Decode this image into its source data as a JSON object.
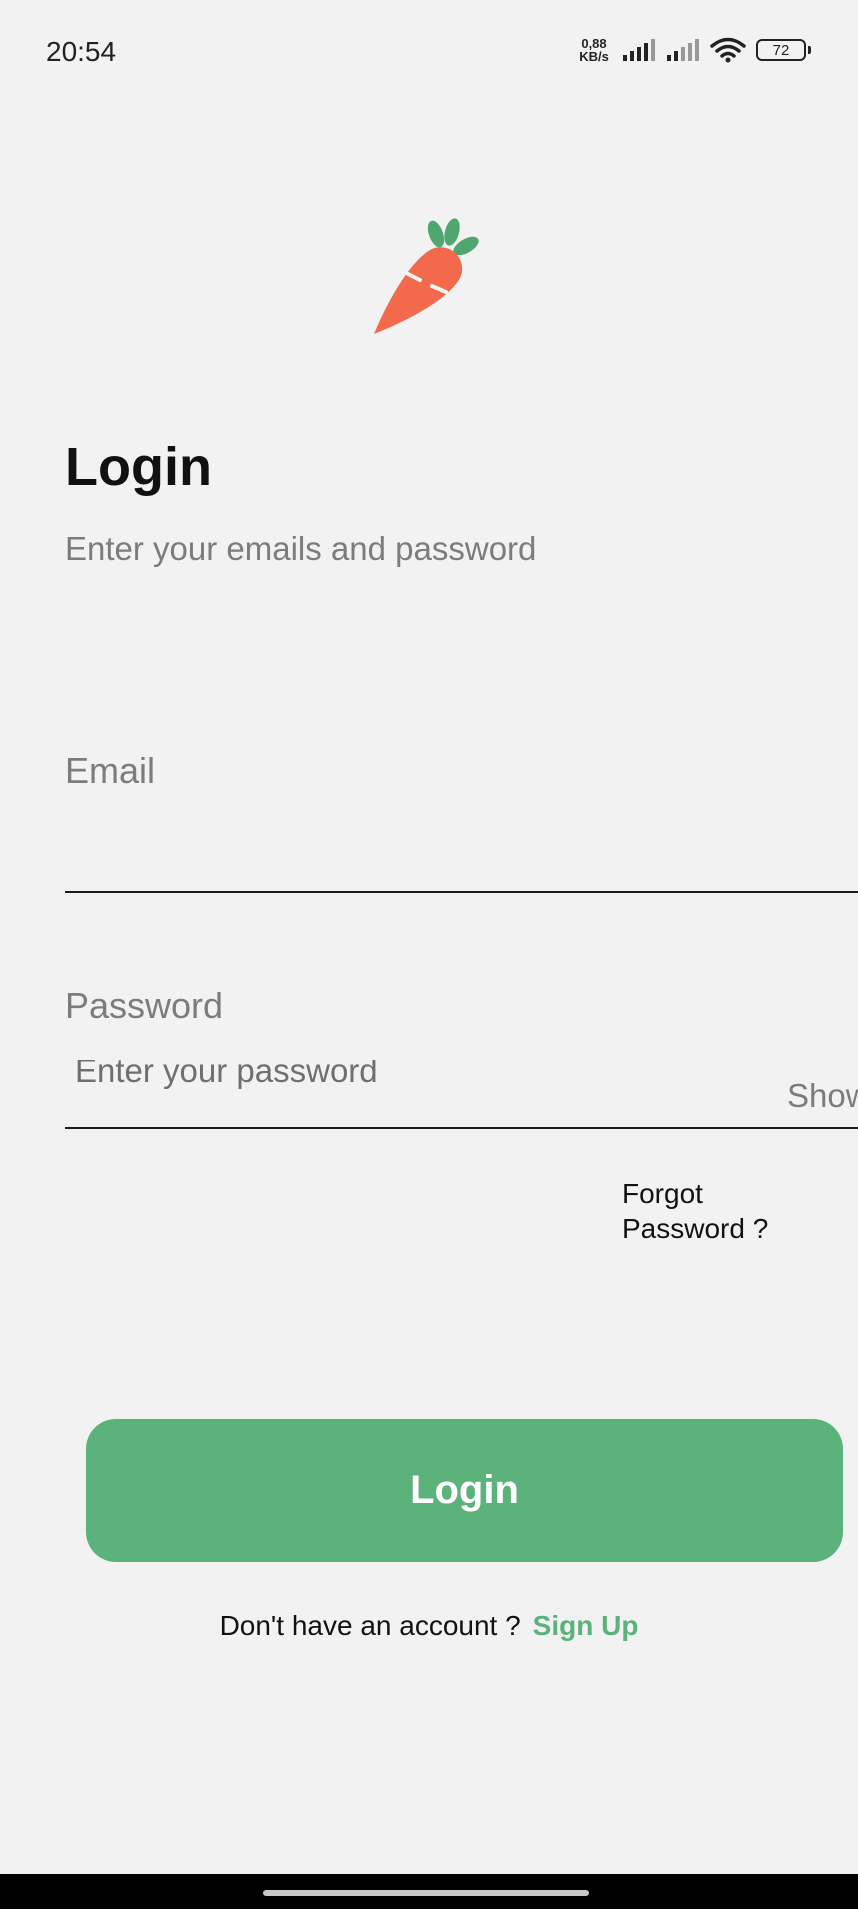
{
  "status_bar": {
    "time": "20:54",
    "net_speed_value": "0,88",
    "net_speed_unit": "KB/s",
    "battery": "72",
    "icons": [
      "signal-icon",
      "signal-icon",
      "wifi-icon",
      "battery-icon"
    ]
  },
  "logo": {
    "icon": "carrot-icon",
    "colors": {
      "body": "#f26a4b",
      "leaves": "#4fa66f"
    }
  },
  "header": {
    "title": "Login",
    "subtitle": "Enter your emails and password"
  },
  "form": {
    "email_label": "Email",
    "email_value": "",
    "password_label": "Password",
    "password_placeholder": "Enter your password",
    "show_toggle": "Show",
    "forgot_password": "Forgot Password ?"
  },
  "actions": {
    "login_label": "Login",
    "signup_prompt": "Don't have an account ?",
    "signup_link": "Sign Up"
  },
  "colors": {
    "accent": "#5cb27b",
    "background": "#f2f2f2",
    "muted_text": "#7c7c7c"
  }
}
